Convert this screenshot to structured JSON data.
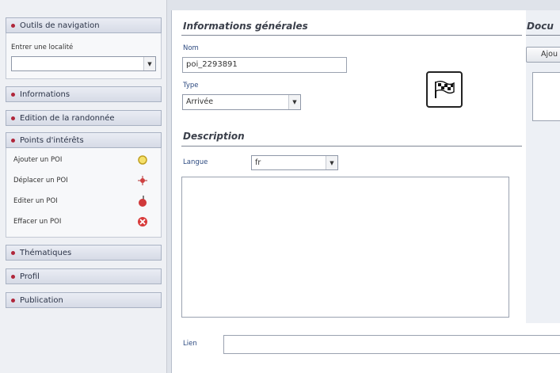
{
  "sidebar": {
    "nav": {
      "header": "Outils de navigation",
      "locality_label": "Entrer une localité",
      "locality_value": ""
    },
    "informations": {
      "header": "Informations"
    },
    "edition": {
      "header": "Edition de la randonnée"
    },
    "poi": {
      "header": "Points d'intérêts",
      "items": [
        {
          "label": "Ajouter un POI",
          "icon": "add-poi-icon"
        },
        {
          "label": "Déplacer un POI",
          "icon": "move-poi-icon"
        },
        {
          "label": "Editer un POI",
          "icon": "edit-poi-icon"
        },
        {
          "label": "Effacer un POI",
          "icon": "delete-poi-icon"
        }
      ]
    },
    "thematiques": {
      "header": "Thématiques"
    },
    "profil": {
      "header": "Profil"
    },
    "publication": {
      "header": "Publication"
    }
  },
  "main": {
    "general": {
      "title": "Informations générales",
      "nom_label": "Nom",
      "nom_value": "poi_2293891",
      "type_label": "Type",
      "type_value": "Arrivée",
      "type_icon": "checkered-flag-icon"
    },
    "description": {
      "title": "Description",
      "langue_label": "Langue",
      "langue_value": "fr",
      "text_value": ""
    },
    "lien": {
      "label": "Lien",
      "value": ""
    },
    "documents": {
      "title": "Docu",
      "add_button": "Ajou"
    }
  },
  "colors": {
    "accent_dot": "#b0263a",
    "label_blue": "#2d4a80",
    "background": "#dfe3ea"
  }
}
